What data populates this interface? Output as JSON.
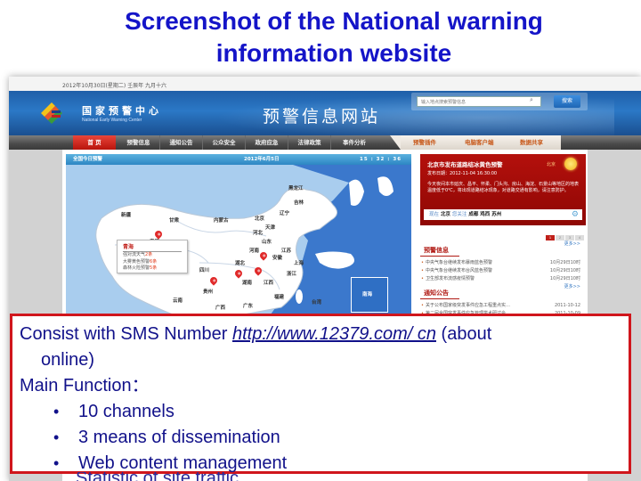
{
  "slide": {
    "title_line1": "Screenshot of the National warning",
    "title_line2": "information website"
  },
  "website": {
    "date_bar": "2012年10月30日(星期二) 壬辰年 九月十六",
    "logo": {
      "name_cn": "国家预警中心",
      "name_en": "National Early Warning Center"
    },
    "site_name": "预警信息网站",
    "search": {
      "placeholder": "输入地点搜索预警信息",
      "button_label": "搜索",
      "icon": "search-icon"
    },
    "nav": {
      "items": [
        {
          "label": "首  页",
          "active": true
        },
        {
          "label": "预警信息",
          "active": false
        },
        {
          "label": "通知公告",
          "active": false
        },
        {
          "label": "公众安全",
          "active": false
        },
        {
          "label": "政府应急",
          "active": false
        },
        {
          "label": "法律政策",
          "active": false
        },
        {
          "label": "事件分析",
          "active": false
        }
      ],
      "special_items": [
        "预警插件",
        "电脑客户端",
        "数据共享"
      ]
    },
    "map_panel": {
      "header_title": "全国今日预警",
      "date": "2012年6月5日",
      "time": "15 : 32 : 36",
      "provinces": [
        "新疆",
        "西藏",
        "青海",
        "甘肃",
        "内蒙古",
        "北京",
        "天津",
        "河北",
        "山东",
        "辽宁",
        "吉林",
        "黑龙江",
        "河南",
        "湖北",
        "安徽",
        "江苏",
        "上海",
        "浙江",
        "江西",
        "湖南",
        "贵州",
        "云南",
        "广西",
        "广东",
        "福建",
        "台湾",
        "四川"
      ],
      "popup": {
        "title": "青海",
        "lines": [
          {
            "label": "强对流天气",
            "value": "2条"
          },
          {
            "label": "大雾黄色预警",
            "value": "6条"
          },
          {
            "label": "森林火险预警",
            "value": "5条"
          }
        ]
      },
      "inset_label": "南海"
    },
    "alert": {
      "title": "北京市发布道路结冰黄色预警",
      "city": "北京",
      "publish_date": "发布日期：2012-11-04  16:30:00",
      "body": "今天夜间本市延庆、昌平、怀柔、门头沟、房山、海淀、石景山等地区的地表温度低于0℃，将出现道路结冰现象，对道路交通有影响，请注意防护。",
      "cities_prefix": "现在",
      "current_city": "北京",
      "switch_label": "您关注",
      "followed_cities": [
        "成都",
        "鸡西",
        "苏州"
      ],
      "pages": [
        "1",
        "2",
        "3",
        "4"
      ],
      "active_page": "1"
    },
    "warning_info": {
      "title": "预警信息",
      "more": "更多>>",
      "items": [
        {
          "text": "中央气象台继续发布暴雨蓝色预警",
          "date": "10月29日10时"
        },
        {
          "text": "中央气象台继续发布台风蓝色预警",
          "date": "10月29日10时"
        },
        {
          "text": "卫生部发布流感疫情预警",
          "date": "10月29日10时"
        }
      ]
    },
    "notices": {
      "title": "通知公告",
      "more": "更多>>",
      "items": [
        {
          "text": "关于公布国家级突发事件应急工程重点实…",
          "date": "2011-10-12"
        },
        {
          "text": "第二届全国突发事件应急管理学术研讨会",
          "date": "2011-10-09"
        }
      ]
    }
  },
  "textbox": {
    "line1_prefix": "Consist with SMS Number ",
    "line1_link": "http://www.12379.com/ cn",
    "line1_suffix": "  (about",
    "line2": "online)",
    "line3": "Main Function：",
    "bullets": [
      "10 channels",
      "3 means of dissemination",
      "Web content management"
    ],
    "cutoff_text": "Statistic of site traffic"
  },
  "colors": {
    "title_blue": "#1414c8",
    "text_navy": "#11118a",
    "box_border_red": "#d0161c",
    "site_blue": "#1f5fa8",
    "alert_red": "#a00c08"
  }
}
